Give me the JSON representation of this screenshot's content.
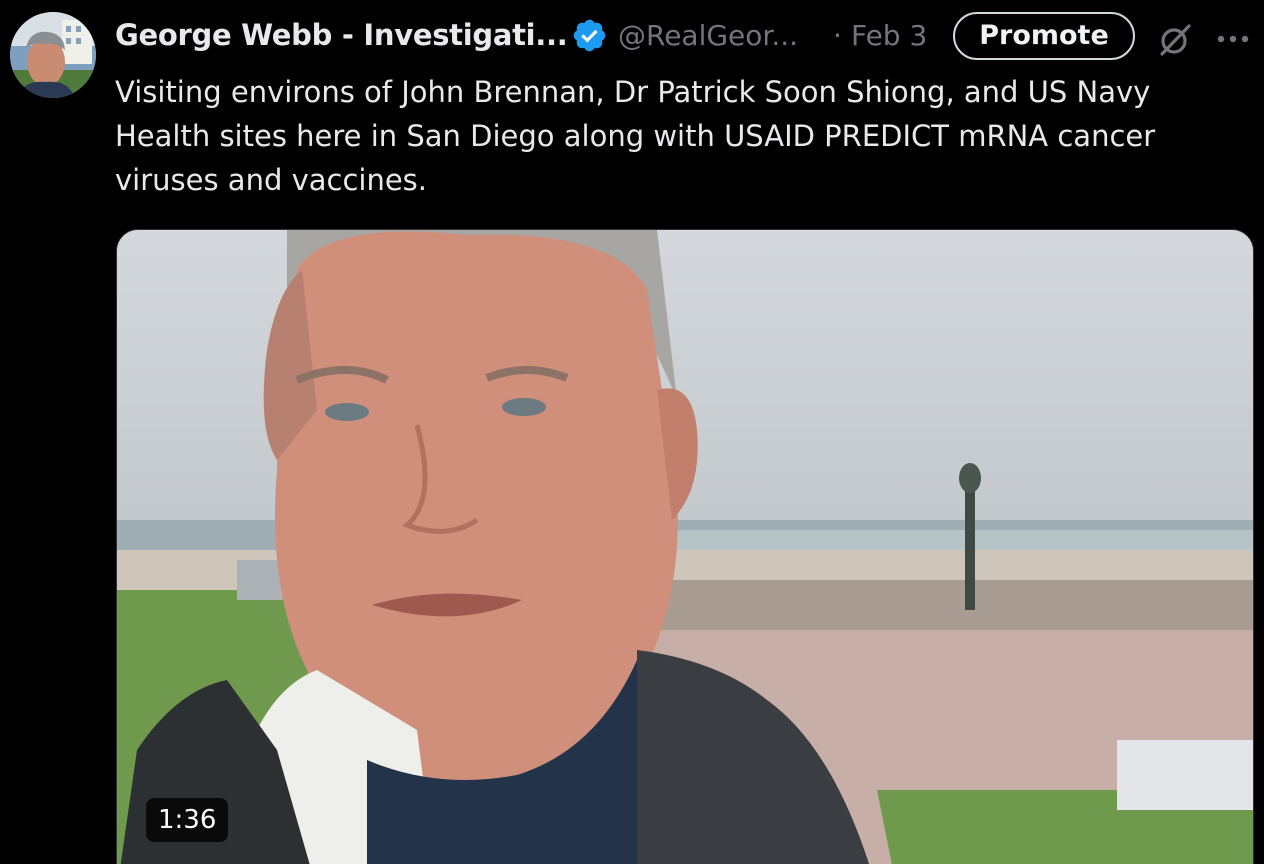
{
  "author": {
    "display_name": "George Webb - Investigati...",
    "handle": "@RealGeor...",
    "separator": "·",
    "date": "Feb 3",
    "verified": true
  },
  "actions": {
    "promote_label": "Promote",
    "grok_icon": "grok-icon",
    "more_icon": "more-icon"
  },
  "tweet": {
    "text": "Visiting environs of John Brennan, Dr Patrick Soon Shiong, and US Navy Health sites here in San Diego along with USAID PREDICT mRNA cancer viruses and vaccines."
  },
  "media": {
    "type": "video",
    "duration": "1:36"
  },
  "colors": {
    "background": "#000000",
    "text_primary": "#e7e9ea",
    "text_secondary": "#71767b",
    "verified_blue": "#1d9bf0"
  }
}
